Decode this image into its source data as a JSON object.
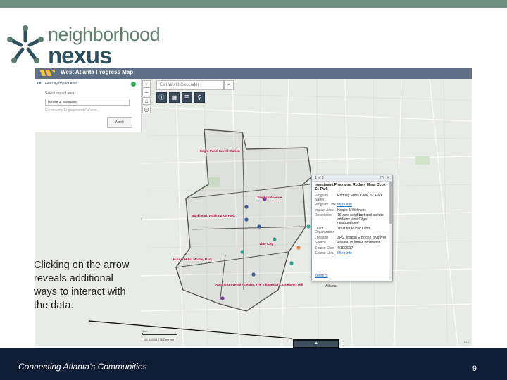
{
  "logo": {
    "line1": "neighborhood",
    "line2": "nexus"
  },
  "map": {
    "title": "West Atlanta Progress Map",
    "filter_panel": {
      "title": "Filter by Impact Area",
      "subtitle": "Select impact area",
      "selected_option": "Health & Wellness",
      "hint": "Community Engagement Fullscre...",
      "apply_label": "Apply"
    },
    "zoom_in": "+",
    "zoom_out": "−",
    "search_placeholder": "Esri World Geocoder",
    "area_labels": [
      "Knight Park/Howell Station",
      "English Avenue",
      "Bankhead, Washington Park",
      "Vine City",
      "Hunter Hills, Mozley Park",
      "Atlanta University Center, The Villages at Castleberry Hill",
      "Atlanta"
    ],
    "popup": {
      "count": "1 of 3",
      "title": "Investment Programs: Rodney Mims Cook Sr. Park",
      "rows": [
        {
          "key": "Program Name",
          "value": "Rodney Mims Cook, Sr. Park"
        },
        {
          "key": "Program Link",
          "value": "More info",
          "link": true
        },
        {
          "key": "Impact Area",
          "value": "Health & Wellness"
        },
        {
          "key": "Description",
          "value": "16-acre neighborhood park to address Vine City's neighborhood"
        },
        {
          "key": "Lead Organization",
          "value": "Trust for Public Land"
        },
        {
          "key": "Location",
          "value": "ZPG Joseph E Boone Blvd NW"
        },
        {
          "key": "Source",
          "value": "Atlanta Journal-Constitution"
        },
        {
          "key": "Source Date",
          "value": "4/10/2017"
        },
        {
          "key": "Source Link",
          "value": "More info",
          "link": true
        }
      ],
      "zoom_to": "Zoom to"
    },
    "scale_label": "1km",
    "coords": "-84.428 33.776 Degrees",
    "credit": "Esri",
    "expand_arrow": "▲"
  },
  "callout": "Clicking on the arrow reveals additional ways to interact with the data.",
  "footer": {
    "text": "Connecting Atlanta's Communities",
    "page_number": "9"
  },
  "colors": {
    "topbar": "#6d8f7f",
    "footer": "#0e1d33",
    "map_header": "#5f6f85"
  }
}
